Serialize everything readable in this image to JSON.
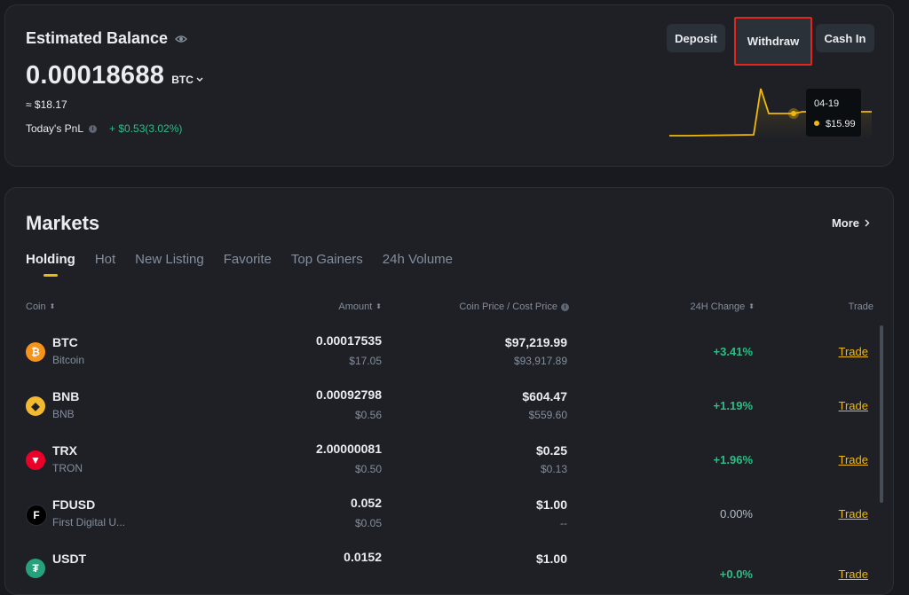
{
  "balance": {
    "title": "Estimated Balance",
    "amount": "0.00018688",
    "currency": "BTC",
    "usd_value": "≈ $18.17",
    "pnl_label": "Today's PnL",
    "pnl_value": "+ $0.53(3.02%)",
    "buttons": {
      "deposit": "Deposit",
      "withdraw": "Withdraw",
      "cash_in": "Cash In"
    },
    "tooltip": {
      "date": "04-19",
      "value": "$15.99"
    }
  },
  "markets": {
    "title": "Markets",
    "more": "More",
    "tabs": [
      "Holding",
      "Hot",
      "New Listing",
      "Favorite",
      "Top Gainers",
      "24h Volume"
    ],
    "active_tab": "Holding",
    "columns": {
      "coin": "Coin",
      "amount": "Amount",
      "price": "Coin Price / Cost Price",
      "change": "24H Change",
      "trade": "Trade"
    },
    "rows": [
      {
        "symbol": "BTC",
        "name": "Bitcoin",
        "amount": "0.00017535",
        "amount_usd": "$17.05",
        "price": "$97,219.99",
        "cost": "$93,917.89",
        "change": "+3.41%",
        "trade": "Trade",
        "icon": "bitcoin-icon",
        "color": "#f7931a"
      },
      {
        "symbol": "BNB",
        "name": "BNB",
        "amount": "0.00092798",
        "amount_usd": "$0.56",
        "price": "$604.47",
        "cost": "$559.60",
        "change": "+1.19%",
        "trade": "Trade",
        "icon": "bnb-icon",
        "color": "#f3ba2f"
      },
      {
        "symbol": "TRX",
        "name": "TRON",
        "amount": "2.00000081",
        "amount_usd": "$0.50",
        "price": "$0.25",
        "cost": "$0.13",
        "change": "+1.96%",
        "trade": "Trade",
        "icon": "tron-icon",
        "color": "#eb0029"
      },
      {
        "symbol": "FDUSD",
        "name": "First Digital U...",
        "amount": "0.052",
        "amount_usd": "$0.05",
        "price": "$1.00",
        "cost": "--",
        "change": "0.00%",
        "trade": "Trade",
        "icon": "fdusd-icon",
        "color": "#000000"
      },
      {
        "symbol": "USDT",
        "name": "",
        "amount": "0.0152",
        "amount_usd": "",
        "price": "$1.00",
        "cost": "",
        "change": "+0.0%",
        "trade": "Trade",
        "icon": "tether-icon",
        "color": "#26a17b"
      }
    ]
  },
  "colors": {
    "accent": "#f0b90b",
    "positive": "#2ebd85",
    "highlight_box": "#e0261d"
  }
}
